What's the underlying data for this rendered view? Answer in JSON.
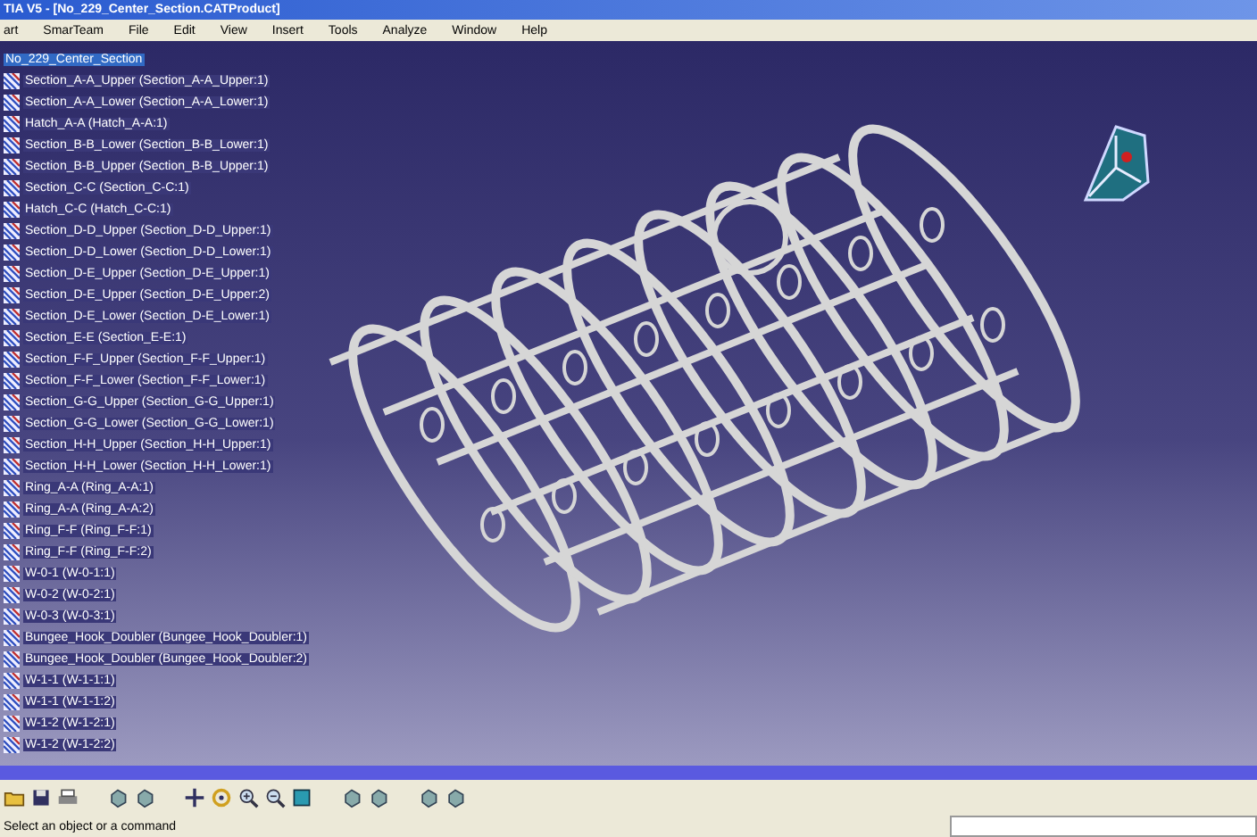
{
  "window": {
    "title": "TIA V5 - [No_229_Center_Section.CATProduct]"
  },
  "menu": [
    "art",
    "SmarTeam",
    "File",
    "Edit",
    "View",
    "Insert",
    "Tools",
    "Analyze",
    "Window",
    "Help"
  ],
  "tree": {
    "root": {
      "label": "No_229_Center_Section",
      "selected": true
    },
    "children": [
      {
        "label": "Section_A-A_Upper (Section_A-A_Upper:1)",
        "selected": false
      },
      {
        "label": "Section_A-A_Lower (Section_A-A_Lower:1)",
        "selected": false
      },
      {
        "label": "Hatch_A-A (Hatch_A-A:1)",
        "selected": false
      },
      {
        "label": "Section_B-B_Lower (Section_B-B_Lower:1)",
        "selected": false
      },
      {
        "label": "Section_B-B_Upper (Section_B-B_Upper:1)",
        "selected": false
      },
      {
        "label": "Section_C-C (Section_C-C:1)",
        "selected": false
      },
      {
        "label": "Hatch_C-C (Hatch_C-C:1)",
        "selected": false
      },
      {
        "label": "Section_D-D_Upper (Section_D-D_Upper:1)",
        "selected": false
      },
      {
        "label": "Section_D-D_Lower (Section_D-D_Lower:1)",
        "selected": false
      },
      {
        "label": "Section_D-E_Upper (Section_D-E_Upper:1)",
        "selected": false
      },
      {
        "label": "Section_D-E_Upper (Section_D-E_Upper:2)",
        "selected": false
      },
      {
        "label": "Section_D-E_Lower (Section_D-E_Lower:1)",
        "selected": false
      },
      {
        "label": "Section_E-E (Section_E-E:1)",
        "selected": false
      },
      {
        "label": "Section_F-F_Upper (Section_F-F_Upper:1)",
        "selected": false
      },
      {
        "label": "Section_F-F_Lower (Section_F-F_Lower:1)",
        "selected": false
      },
      {
        "label": "Section_G-G_Upper (Section_G-G_Upper:1)",
        "selected": false
      },
      {
        "label": "Section_G-G_Lower (Section_G-G_Lower:1)",
        "selected": false
      },
      {
        "label": "Section_H-H_Upper (Section_H-H_Upper:1)",
        "selected": false
      },
      {
        "label": "Section_H-H_Lower (Section_H-H_Lower:1)",
        "selected": false
      },
      {
        "label": "Ring_A-A (Ring_A-A:1)",
        "selected": false
      },
      {
        "label": "Ring_A-A (Ring_A-A:2)",
        "selected": false
      },
      {
        "label": "Ring_F-F (Ring_F-F:1)",
        "selected": false
      },
      {
        "label": "Ring_F-F (Ring_F-F:2)",
        "selected": false
      },
      {
        "label": "W-0-1 (W-0-1:1)",
        "selected": false
      },
      {
        "label": "W-0-2 (W-0-2:1)",
        "selected": false
      },
      {
        "label": "W-0-3 (W-0-3:1)",
        "selected": false
      },
      {
        "label": "Bungee_Hook_Doubler (Bungee_Hook_Doubler:1)",
        "selected": false
      },
      {
        "label": "Bungee_Hook_Doubler (Bungee_Hook_Doubler:2)",
        "selected": false
      },
      {
        "label": "W-1-1 (W-1-1:1)",
        "selected": false
      },
      {
        "label": "W-1-1 (W-1-1:2)",
        "selected": false
      },
      {
        "label": "W-1-2 (W-1-2:1)",
        "selected": false
      },
      {
        "label": "W-1-2 (W-1-2:2)",
        "selected": false
      }
    ]
  },
  "status_bar": {
    "message": "Select an object or a command"
  }
}
